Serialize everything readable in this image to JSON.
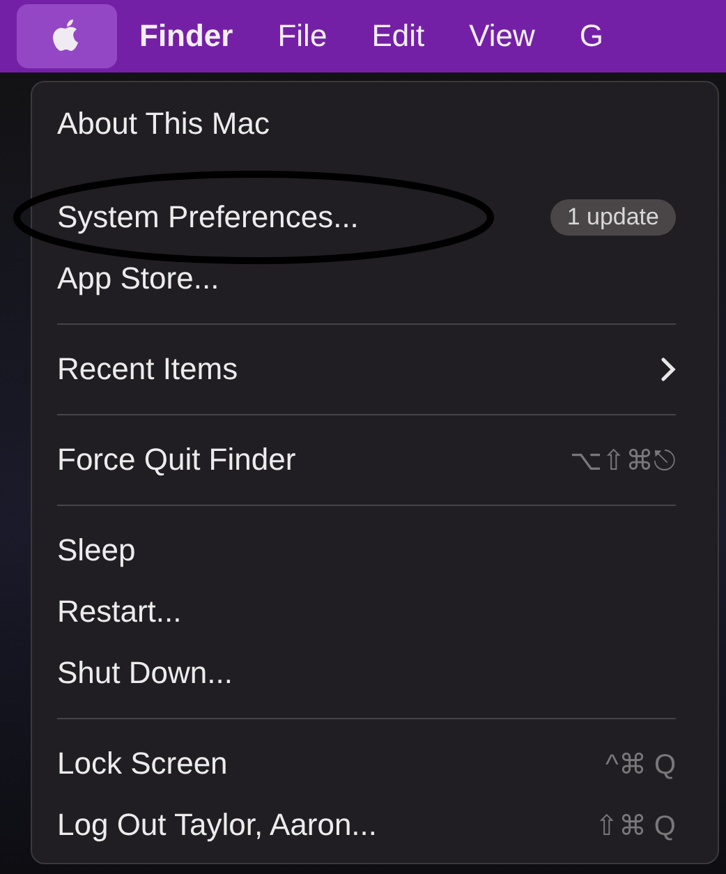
{
  "menu_bar": [
    {
      "kind": "apple",
      "selected": true
    },
    {
      "kind": "app",
      "label": "Finder",
      "selected": false
    },
    {
      "kind": "menu",
      "label": "File",
      "selected": false
    },
    {
      "kind": "menu",
      "label": "Edit",
      "selected": false
    },
    {
      "kind": "menu",
      "label": "View",
      "selected": false
    },
    {
      "kind": "menu",
      "label": "G",
      "selected": false
    }
  ],
  "menu": {
    "sections": [
      {
        "items": [
          {
            "label": "About This Mac"
          },
          {
            "label": "System Preferences...",
            "badge": "1 update"
          },
          {
            "label": "App Store..."
          }
        ]
      },
      {
        "items": [
          {
            "label": "Recent Items",
            "submenu": true
          }
        ]
      },
      {
        "items": [
          {
            "label": "Force Quit Finder",
            "shortcut": "⌥⇧⌘⎋"
          }
        ]
      },
      {
        "items": [
          {
            "label": "Sleep"
          },
          {
            "label": "Restart..."
          },
          {
            "label": "Shut Down..."
          }
        ]
      },
      {
        "items": [
          {
            "label": "Lock Screen",
            "shortcut": "^⌘ Q"
          },
          {
            "label": "Log Out Taylor, Aaron...",
            "shortcut": "⇧⌘ Q"
          }
        ]
      }
    ]
  }
}
